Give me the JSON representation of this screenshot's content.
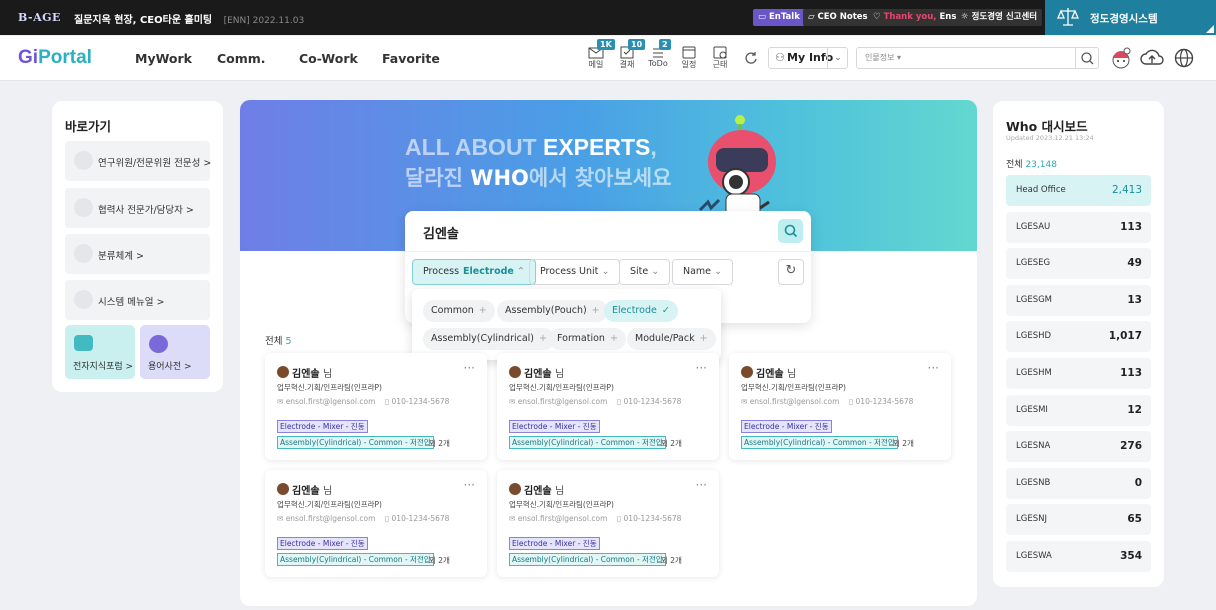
{
  "topbar": {
    "logo": "B-AGE",
    "notice": "질문지옥 현장, CEO타운 홀미팅",
    "notice_date": "[ENN] 2022.11.03",
    "entalk": "EnTalk",
    "ceo_notes": "CEO Notes",
    "thank_you": "Thank you,",
    "thank_you_name": "Ensol",
    "report_center": "정도경영 신고센터",
    "ethics_system": "정도경영시스템"
  },
  "header": {
    "brand_prefix": "Gi",
    "brand": "Portal",
    "nav": [
      "MyWork",
      "Comm.",
      "Co-Work",
      "Favorite"
    ],
    "quick": [
      {
        "label": "메일",
        "badge": "1K"
      },
      {
        "label": "결재",
        "badge": "10"
      },
      {
        "label": "ToDo",
        "badge": "2"
      },
      {
        "label": "일정",
        "badge": ""
      },
      {
        "label": "근태",
        "badge": ""
      }
    ],
    "myinfo": "My Info",
    "search_scope": "인물정보"
  },
  "left": {
    "title": "바로가기",
    "items": [
      "연구위원/전문위원 전문성 >",
      "협력사 전문가/담당자 >",
      "분류체계 >",
      "시스템 메뉴얼 >"
    ],
    "forum": "전자지식포럼 >",
    "dictionary": "용어사전 >"
  },
  "banner": {
    "line1_a": "ALL ABOUT",
    "line1_b": "EXPERTS",
    "line1_c": ",",
    "line2_a": "달라진",
    "line2_b": "WHO",
    "line2_c": "에서 찾아보세요"
  },
  "search": {
    "query": "김엔솔",
    "filters": {
      "process_label": "Process",
      "process_value": "Electrode",
      "unit": "Process Unit",
      "site": "Site",
      "name": "Name"
    },
    "options": [
      {
        "label": "Common",
        "selected": false
      },
      {
        "label": "Assembly(Pouch)",
        "selected": false
      },
      {
        "label": "Electrode",
        "selected": true
      },
      {
        "label": "Assembly(Cylindrical)",
        "selected": false
      },
      {
        "label": "Formation",
        "selected": false
      },
      {
        "label": "Module/Pack",
        "selected": false
      }
    ]
  },
  "results": {
    "total_label": "전체",
    "total": "5",
    "cards": [
      {
        "name": "김엔솔",
        "suffix": "님",
        "dept": "업무혁신.기획/인프라팀(인프라P)",
        "email": "ensol.first@lgensol.com",
        "phone": "010-1234-5678",
        "tag1": "Electrode - Mixer - 진동",
        "tag2": "Assembly(Cylindrical) - Common - 저전압",
        "extra": "외 2개"
      },
      {
        "name": "김엔솔",
        "suffix": "님",
        "dept": "업무혁신.기획/인프라팀(인프라P)",
        "email": "ensol.first@lgensol.com",
        "phone": "010-1234-5678",
        "tag1": "Electrode - Mixer - 진동",
        "tag2": "Assembly(Cylindrical) - Common - 저전압",
        "extra": "외 2개"
      },
      {
        "name": "김엔솔",
        "suffix": "님",
        "dept": "업무혁신.기획/인프라팀(인프라P)",
        "email": "ensol.first@lgensol.com",
        "phone": "010-1234-5678",
        "tag1": "Electrode - Mixer - 진동",
        "tag2": "Assembly(Cylindrical) - Common - 저전압",
        "extra": "외 2개"
      },
      {
        "name": "김엔솔",
        "suffix": "님",
        "dept": "업무혁신.기획/인프라팀(인프라P)",
        "email": "ensol.first@lgensol.com",
        "phone": "010-1234-5678",
        "tag1": "Electrode - Mixer - 진동",
        "tag2": "Assembly(Cylindrical) - Common - 저전압",
        "extra": "외 2개"
      },
      {
        "name": "김엔솔",
        "suffix": "님",
        "dept": "업무혁신.기획/인프라팀(인프라P)",
        "email": "ensol.first@lgensol.com",
        "phone": "010-1234-5678",
        "tag1": "Electrode - Mixer - 진동",
        "tag2": "Assembly(Cylindrical) - Common - 저전압",
        "extra": "외 2개"
      }
    ]
  },
  "dashboard": {
    "title": "Who 대시보드",
    "updated": "Updated 2023.12.21 13:24",
    "total_label": "전체",
    "total": "23,148",
    "rows": [
      {
        "name": "Head Office",
        "value": "2,413"
      },
      {
        "name": "LGESAU",
        "value": "113"
      },
      {
        "name": "LGESEG",
        "value": "49"
      },
      {
        "name": "LGESGM",
        "value": "13"
      },
      {
        "name": "LGESHD",
        "value": "1,017"
      },
      {
        "name": "LGESHM",
        "value": "113"
      },
      {
        "name": "LGESMI",
        "value": "12"
      },
      {
        "name": "LGESNA",
        "value": "276"
      },
      {
        "name": "LGESNB",
        "value": "0"
      },
      {
        "name": "LGESNJ",
        "value": "65"
      },
      {
        "name": "LGESWA",
        "value": "354"
      }
    ]
  }
}
